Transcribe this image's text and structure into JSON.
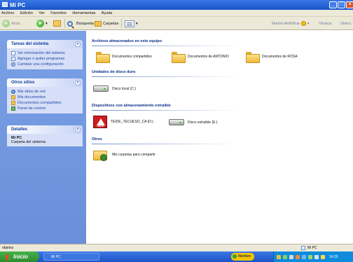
{
  "window": {
    "title": "Mi PC"
  },
  "menu": [
    "Archivo",
    "Edición",
    "Ver",
    "Favoritos",
    "Herramientas",
    "Ayuda"
  ],
  "toolbar": {
    "back_label": "Atrás",
    "search_label": "Búsqueda",
    "folders_label": "Carpetas",
    "norton_label": "Norton AntiVirus",
    "norton_extra": "Virusca",
    "direccion": "Direcc"
  },
  "sidebar": {
    "tasks": {
      "title": "Tareas del sistema",
      "items": [
        "Ver información del sistema",
        "Agregar o quitar programas",
        "Cambiar una configuración"
      ]
    },
    "other": {
      "title": "Otros sitios",
      "items": [
        "Mis sitios de red",
        "Mis documentos",
        "Documentos compartidos",
        "Panel de control"
      ]
    },
    "details": {
      "title": "Detalles",
      "name": "Mi PC",
      "description": "Carpeta del sistema"
    }
  },
  "main": {
    "stored": {
      "heading": "Archivos almacenados en este equipo",
      "items": [
        "Documentos compartidos",
        "Documentos de ANTONIO",
        "Documentos de ROSA"
      ]
    },
    "hard_disks": {
      "heading": "Unidades de disco duro",
      "items": [
        "Disco local (C:)"
      ]
    },
    "removable": {
      "heading": "Dispositivos con almacenamiento extraíble",
      "items": [
        "TEIDE_TECUESO_CA (D:)",
        "Disco extraíble (E:)"
      ],
      "logo_text": "TEIDE"
    },
    "others": {
      "heading": "Otros",
      "items": [
        "Mis carpetas para compartir"
      ]
    }
  },
  "statusbar": {
    "left": "objetos",
    "right": "Mi PC"
  },
  "taskbar": {
    "start": "Inicio",
    "task": "Mi PC",
    "norton": "Norton",
    "clock": "14:20"
  }
}
